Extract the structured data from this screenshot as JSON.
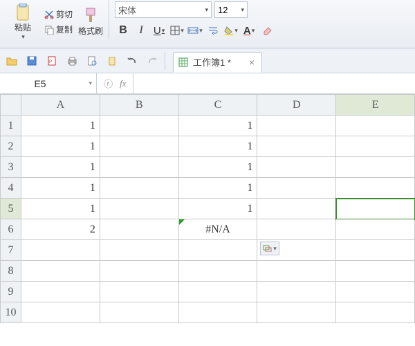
{
  "ribbon": {
    "paste": "粘贴",
    "cut": "剪切",
    "copy": "复制",
    "format_painter": "格式刷",
    "font_name": "宋体",
    "font_size": "12",
    "bold": "B",
    "italic": "I",
    "underline": "U"
  },
  "doc_tab": {
    "title": "工作簿1 *"
  },
  "namebox": {
    "value": "E5"
  },
  "formula": {
    "value": ""
  },
  "columns": [
    "A",
    "B",
    "C",
    "D",
    "E"
  ],
  "rows": [
    "1",
    "2",
    "3",
    "4",
    "5",
    "6",
    "7",
    "8",
    "9",
    "10"
  ],
  "cells": {
    "A1": "1",
    "C1": "1",
    "A2": "1",
    "C2": "1",
    "A3": "1",
    "C3": "1",
    "A4": "1",
    "C4": "1",
    "A5": "1",
    "C5": "1",
    "A6": "2",
    "C6": "#N/A"
  },
  "active": {
    "col": "E",
    "row": "5"
  },
  "error_cells": [
    "C6"
  ],
  "smarttag": {
    "anchor": "D7"
  },
  "colors": {
    "select": "#3a8a2e",
    "header_sel": "#dfe9d6"
  }
}
